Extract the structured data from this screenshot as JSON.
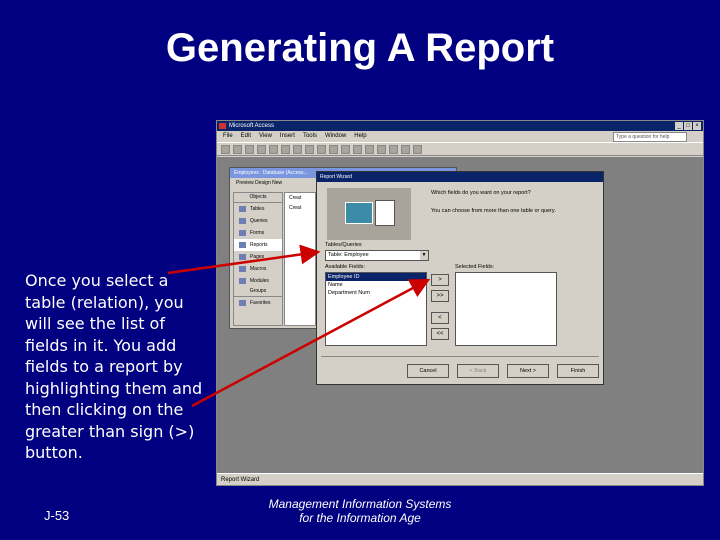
{
  "slide": {
    "title": "Generating A Report",
    "caption": "Once you select a table (relation), you will see the list of fields in it.  You add fields to a report by highlighting them and then clicking on the greater than sign (>) button.",
    "page_number": "J-53",
    "footer": [
      "Management Information Systems",
      "for the Information Age"
    ]
  },
  "screenshot": {
    "app_title": "Microsoft Access",
    "menu": [
      "File",
      "Edit",
      "View",
      "Insert",
      "Tools",
      "Window",
      "Help"
    ],
    "help_box_placeholder": "Type a question for help",
    "db_window": {
      "title": "Employees : Database (Access...",
      "toolbar": "Preview  Design  New",
      "objects_header": "Objects",
      "objects": [
        "Tables",
        "Queries",
        "Forms",
        "Reports",
        "Pages",
        "Macros",
        "Modules"
      ],
      "groups_header": "Groups",
      "groups": [
        "Favorites"
      ],
      "list_items": [
        "Creat",
        "Creat"
      ]
    },
    "wizard": {
      "title": "Report Wizard",
      "question": "Which fields do you want on your report?",
      "subtext": "You can choose from more than one table or query.",
      "tables_label": "Tables/Queries",
      "table_value": "Table: Employee",
      "available_label": "Available Fields:",
      "selected_label": "Selected Fields:",
      "available_fields": [
        "Employee ID",
        "Name",
        "Department Num"
      ],
      "move_buttons": [
        ">",
        ">>",
        "<",
        "<<"
      ],
      "footer_buttons": [
        "Cancel",
        "< Back",
        "Next >",
        "Finish"
      ]
    },
    "status_text": "Report Wizard"
  },
  "colors": {
    "slide_background": "#000080",
    "arrow": "#cc0000",
    "title_bar": "#0a246a"
  }
}
